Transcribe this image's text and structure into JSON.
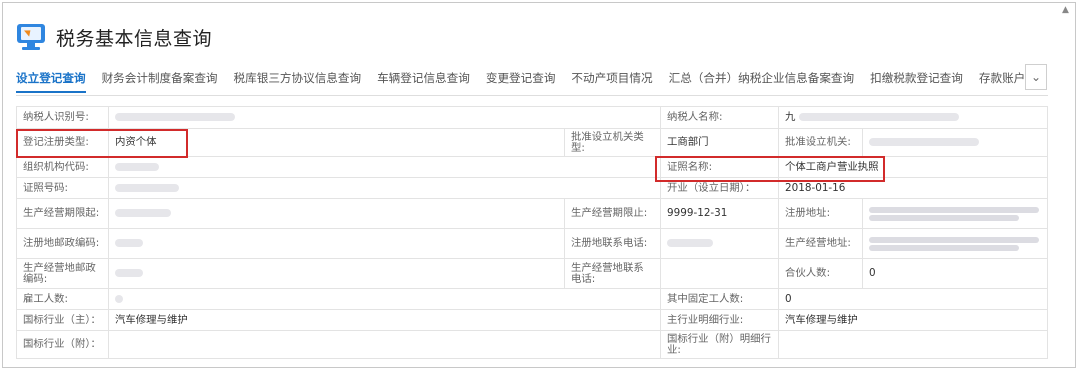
{
  "header": {
    "title": "税务基本信息查询"
  },
  "tabs": [
    {
      "label": "设立登记查询",
      "active": true
    },
    {
      "label": "财务会计制度备案查询"
    },
    {
      "label": "税库银三方协议信息查询"
    },
    {
      "label": "车辆登记信息查询"
    },
    {
      "label": "变更登记查询"
    },
    {
      "label": "不动产项目情况"
    },
    {
      "label": "汇总（合并）纳税企业信息备案查询"
    },
    {
      "label": "扣缴税款登记查询"
    },
    {
      "label": "存款账户账"
    }
  ],
  "fields": {
    "taxpayer_id_label": "纳税人识别号:",
    "taxpayer_name_label": "纳税人名称:",
    "taxpayer_name_value": "九",
    "reg_type_label": "登记注册类型:",
    "reg_type_value": "内资个体",
    "approval_org_type_label": "批准设立机关类型:",
    "approval_org_type_value": "工商部门",
    "approval_org_label": "批准设立机关:",
    "org_code_label": "组织机构代码:",
    "cert_name_label": "证照名称:",
    "cert_name_value": "个体工商户营业执照",
    "cert_no_label": "证照号码:",
    "open_date_label": "开业（设立日期）：",
    "open_date_value": "2018-01-16",
    "op_start_label": "生产经营期限起:",
    "op_end_label": "生产经营期限止:",
    "op_end_value": "9999-12-31",
    "reg_addr_label": "注册地址:",
    "reg_post_label": "注册地邮政编码:",
    "reg_phone_label": "注册地联系电话:",
    "op_addr_label": "生产经营地址:",
    "op_post_label": "生产经营地邮政编码:",
    "op_phone_label": "生产经营地联系电话:",
    "partners_label": "合伙人数:",
    "partners_value": "0",
    "employees_label": "雇工人数:",
    "fixed_workers_label": "其中固定工人数:",
    "fixed_workers_value": "0",
    "industry_main_label": "国标行业（主）：",
    "industry_main_value": "汽车修理与维护",
    "industry_main_detail_label": "主行业明细行业:",
    "industry_main_detail_value": "汽车修理与维护",
    "industry_sub_label": "国标行业（附）：",
    "industry_sub_detail_label": "国标行业（附）明细行业:"
  }
}
